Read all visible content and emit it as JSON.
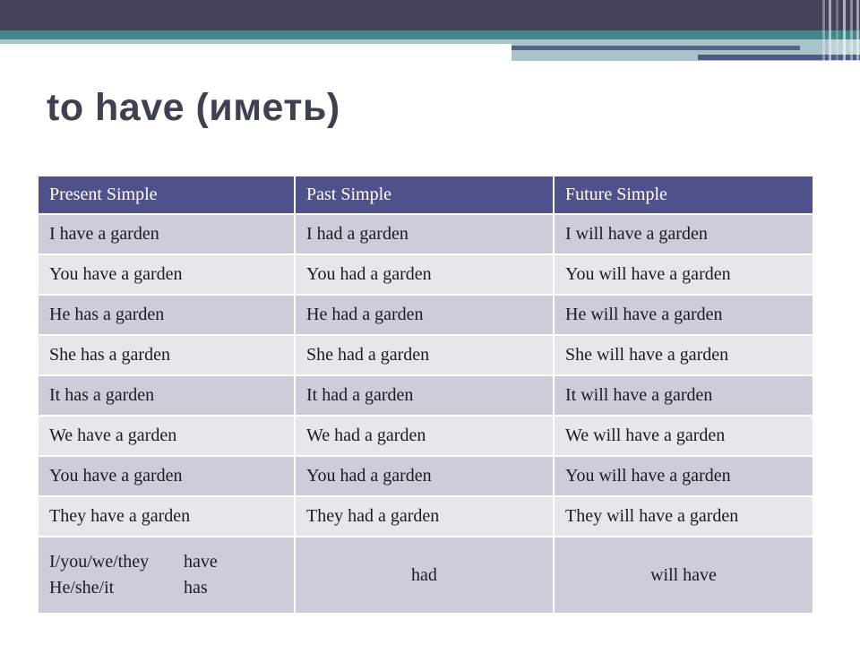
{
  "slide": {
    "title": "to have (иметь)"
  },
  "decor": {
    "navy": "#434257",
    "teal": "#44858b",
    "light_blue": "#a9c3cb",
    "slate_line": "#55628f",
    "header_fill": "#50508a",
    "row_dark": "#cdcdd9",
    "row_light": "#e7e7eb"
  },
  "table": {
    "columns": [
      "Present Simple",
      "Past Simple",
      "Future Simple"
    ],
    "rows": [
      [
        "I have a garden",
        "I had a garden",
        "I will have a garden"
      ],
      [
        "You have a garden",
        "You had a garden",
        "You will have a garden"
      ],
      [
        "He has a garden",
        "He had a garden",
        "He will have a garden"
      ],
      [
        "She has a garden",
        "She had a garden",
        "She will have a garden"
      ],
      [
        "It has a garden",
        "It had a garden",
        "It will have a garden"
      ],
      [
        "We have a garden",
        "We had a garden",
        "We will have a garden"
      ],
      [
        "You have a garden",
        "You had a garden",
        "You will have a garden"
      ],
      [
        "They have a garden",
        "They had a garden",
        "They will have a garden"
      ]
    ],
    "summary": {
      "present_line1_subject": "I/you/we/they",
      "present_line1_verb": "have",
      "present_line2_subject": "He/she/it",
      "present_line2_verb": "has",
      "past": "had",
      "future": "will have"
    }
  }
}
